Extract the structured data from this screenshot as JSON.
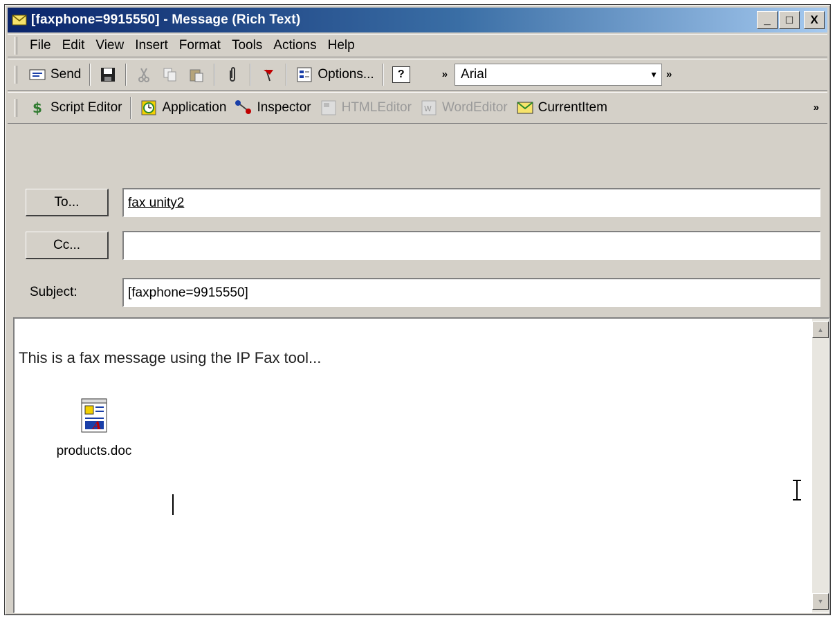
{
  "window": {
    "title": "[faxphone=9915550] - Message (Rich Text)",
    "controls": [
      "_",
      "□",
      "X"
    ]
  },
  "menu": [
    "File",
    "Edit",
    "View",
    "Insert",
    "Format",
    "Tools",
    "Actions",
    "Help"
  ],
  "toolbar": {
    "send_label": "Send",
    "options_label": "Options...",
    "help_label": "?",
    "font_name": "Arial",
    "more_label": "»"
  },
  "toolbar2": {
    "script_editor": "Script Editor",
    "application": "Application",
    "inspector": "Inspector",
    "html_editor": "HTMLEditor",
    "word_editor": "WordEditor",
    "current_item": "CurrentItem"
  },
  "fields": {
    "to_button": "To...",
    "to_value": "fax unity2",
    "cc_button": "Cc...",
    "cc_value": "",
    "subject_label": "Subject:",
    "subject_value": "[faxphone=9915550]"
  },
  "body": {
    "text": "This is a fax message using the IP Fax tool...",
    "attachment_name": "products.doc"
  },
  "colors": {
    "title_start": "#0a246a",
    "title_end": "#a6caf0",
    "chrome": "#d4d0c8"
  }
}
